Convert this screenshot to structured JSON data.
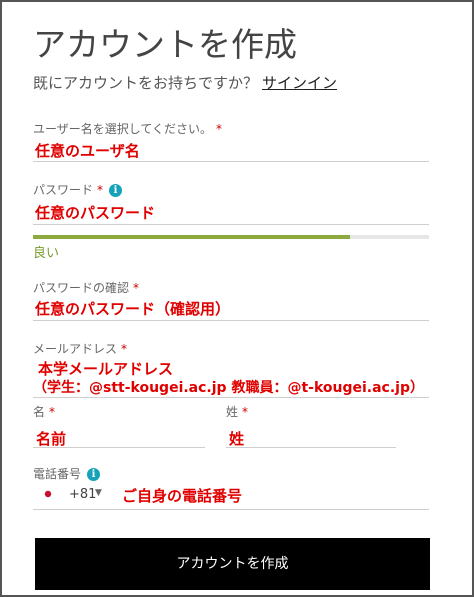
{
  "title": "アカウントを作成",
  "subtitle": {
    "text": "既にアカウントをお持ちですか？",
    "link": "サインイン"
  },
  "username": {
    "label": "ユーザー名を選択してください。",
    "required": "*",
    "value": "任意のユーザ名"
  },
  "password": {
    "label": "パスワード",
    "required": "*",
    "info_icon": "info-icon",
    "info_text": "i",
    "value": "任意のパスワード",
    "strength": "良い",
    "strength_ratio": 0.8,
    "strength_color": "#8caa3e"
  },
  "password_confirm": {
    "label": "パスワードの確認",
    "required": "*",
    "value": "任意のパスワード（確認用）"
  },
  "email": {
    "label": "メールアドレス",
    "required": "*",
    "value_line1": "本学メールアドレス",
    "value_line2": "（学生：@stt-kougei.ac.jp 教職員：@t-kougei.ac.jp）"
  },
  "first_name": {
    "label": "名",
    "required": "*",
    "value": "名前"
  },
  "last_name": {
    "label": "姓",
    "required": "*",
    "value": "姓"
  },
  "phone": {
    "label": "電話番号",
    "info_icon": "info-icon",
    "info_text": "i",
    "country_code": "+81",
    "caret": "▼",
    "value": "ご自身の電話番号"
  },
  "submit": {
    "label": "アカウントを作成"
  },
  "colors": {
    "accent": "#14a3b8",
    "required": "#cc0000",
    "annotation": "#e00000",
    "button": "#000000"
  }
}
